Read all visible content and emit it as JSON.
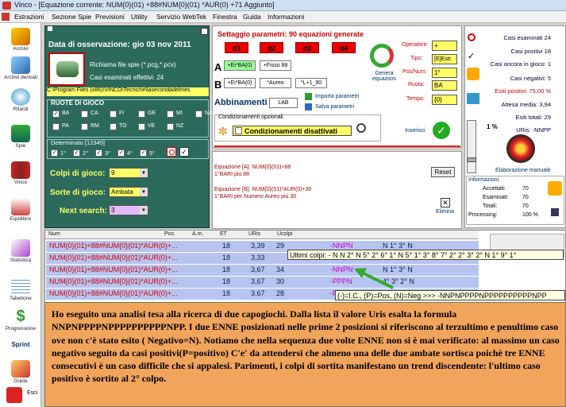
{
  "window": {
    "title": "Vinco - [Equazione corrente: NUM{0}(01) +88#NUM{0}(01) *AUR(0) +71 Aggiunto]"
  },
  "menu": [
    "Estrazioni",
    "Sezione Spie",
    "Previsioni",
    "Utility",
    "Servizio WebTek",
    "Finestra",
    "Guida",
    "Informazioni"
  ],
  "sidebar": [
    {
      "label": "Archivi",
      "icon": "pencil-icon"
    },
    {
      "label": "Archivi derivati",
      "icon": "book-icon"
    },
    {
      "label": "Ritardi",
      "icon": "clock-icon"
    },
    {
      "label": "Spie",
      "icon": "house-icon"
    },
    {
      "label": "Vinco",
      "icon": "books-icon"
    },
    {
      "label": "Equilibrio",
      "icon": "scale-icon"
    },
    {
      "label": "Statistica",
      "icon": "chart-icon"
    },
    {
      "label": "Tabellone",
      "icon": "table-icon"
    },
    {
      "label": "Progressione",
      "icon": "dollar-icon"
    },
    {
      "label": "Sprint",
      "icon": "sprint-icon"
    },
    {
      "label": "Guida",
      "icon": "help-icon"
    },
    {
      "label": "Esci",
      "icon": "exit-icon"
    }
  ],
  "observation": {
    "date": "Data di osservazione: gio 03 nov 2011",
    "recall": "Richiama file spie (*.pcg,*.pcv)",
    "cases": "Casi esaminati effettivi: 24",
    "path": "C:\\Program Files (x86)\\VINCO\\Tecniche\\lasecondadelmes"
  },
  "ruote": {
    "title": "RUOTE DI GIOCO",
    "wheels": [
      "BA",
      "CA",
      "FI",
      "GE",
      "MI",
      "NA",
      "PA",
      "RM",
      "TO",
      "VE",
      "NZ"
    ],
    "checked": [
      "BA"
    ]
  },
  "determinato": {
    "title": "Determinato [12345]",
    "items": [
      "1°",
      "2°",
      "3°",
      "4°",
      "5°"
    ]
  },
  "colpi": {
    "label": "Colpi di gioco:",
    "value": "9"
  },
  "sorte": {
    "label": "Sorte di gioco:",
    "value": "Ambata"
  },
  "next": {
    "label": "Next search:",
    "value": "3"
  },
  "settaggio": {
    "title": "Settaggio parametri: 90 equazioni generate",
    "d": [
      "d1",
      "d2",
      "d3",
      "d4"
    ],
    "a_label": "A",
    "b_label": "B",
    "a1": "+Ei*BA{0}",
    "a2": "+Fisso 88",
    "b1": "+Ei*BA{0}",
    "b2": "*Aureo",
    "b3": "*L+1_90",
    "genera": "Genera equazioni",
    "abbinamenti": "Abbinamenti",
    "abb_value": "LAB",
    "importa": "Importa parametri",
    "salva": "Salva parametri",
    "cond_title": "Condizionamenti opzionali",
    "cond_value": "Condizionamenti disattivati",
    "operatore_label": "Operatore:",
    "operatore": "+",
    "tipo_label": "Tipo:",
    "tipo": "[E]Estr.",
    "posnum_label": "Pos/Num:",
    "posnum": "1°",
    "ruota_label": "Ruota:",
    "ruota": "BA",
    "tempo_label": "Tempo:",
    "tempo": "{0}",
    "inserisci": "Inserisci"
  },
  "equations": {
    "a1": "Equazione [A]: NUM{0}(01)+88",
    "a2": "1°BARI più 88",
    "b1": "Equazione [B]: NUM{0}(01)*AUR(0)+30",
    "b2": "1°BARI per  Numero Aureo  più 30",
    "reset": "Reset",
    "elimina": "Elimina"
  },
  "stats": {
    "esaminati": "Casi esaminati 24",
    "positivi": "Casi positivi 18",
    "ancora": "Casi ancora in gioco: 1",
    "negativi": "Casi negativi: 5",
    "esiti": "Esiti positivi: 75,00 %",
    "attesa": "Attesa media: 3,94",
    "totali": "Esiti totali: 29",
    "uris": "URis: -NNPP",
    "percent": "1 %",
    "elab": "Elaborazione manuale"
  },
  "info": {
    "title": "Informazioni",
    "accettati": "Accettati:",
    "acc_v": "70",
    "esaminati": "Esaminati:",
    "esa_v": "70",
    "totali": "Totali:",
    "tot_v": "70",
    "processing": "Processing:",
    "proc_v": "100 %"
  },
  "table": {
    "headers": [
      "Num",
      "Pos",
      "A.m.",
      "ET",
      "URis",
      "Ucolpi"
    ],
    "rows": [
      {
        "eq": "NUM{0}(01)+88#NUM{0}(01)*AUR(0)+...",
        "et": "18",
        "uris": "3,39",
        "uc": "29",
        "code": "-NNPN",
        "extra": "N 1° 3° N"
      },
      {
        "eq": "NUM{0}(01)+88#NUM{0}(01)*AUR(0)+...",
        "et": "18",
        "uris": "3,33",
        "uc": "",
        "code": "",
        "extra": ""
      },
      {
        "eq": "NUM{0}(01)+88#NUM{0}(01)*AUR(0)+...",
        "et": "18",
        "uris": "3,67",
        "uc": "34",
        "code": "-NNPN",
        "extra": "N 1° 3° N"
      },
      {
        "eq": "NUM{0}(01)+88#NUM{0}(01)*AUR(0)+...",
        "et": "18",
        "uris": "3,67",
        "uc": "30",
        "code": "-PPPN",
        "extra": "4° 3° 2° N"
      },
      {
        "eq": "NUM{0}(01)+88#NUM{0}(01)*AUR(0)+...",
        "et": "18",
        "uris": "3,67",
        "uc": "28",
        "code": "-P",
        "extra": ""
      }
    ]
  },
  "tooltip": "Ultimi colpi: - N N 2° N 5° 2° 6° 1° N 5° 1° 3° 8° 7° 2° 2° 3° 2° N 1° 9° 1°",
  "tooltip2": "(-)=I.C., (P)=Pos, (N)=Neg >>> -NNPNPPPPNPPPPPPPPPPNPP",
  "note": "Ho eseguito una analisi tesa alla ricerca di due capogiochi. Dalla lista il valore Uris esalta la formula NNPNPPPPNPPPPPPPPPPNPP. I due ENNE posizionati nelle prime 2 posizioni si riferiscono al terzultimo e penultimo caso ove non c'è stato esito ( Negativo=N). Notiamo che nella sequenza due volte ENNE non si è mai verificato: al massimo un caso negativo seguito da casi positivi(P=positivo) C'e' da attendersi che almeno una delle due ambate sortisca poichè tre ENNE consecutivi è un caso difficile che si appalesi. Parimenti, i colpi di sortita manifestano un trend discendente: l'ultimo caso positivo è sortito al 2° colpo."
}
